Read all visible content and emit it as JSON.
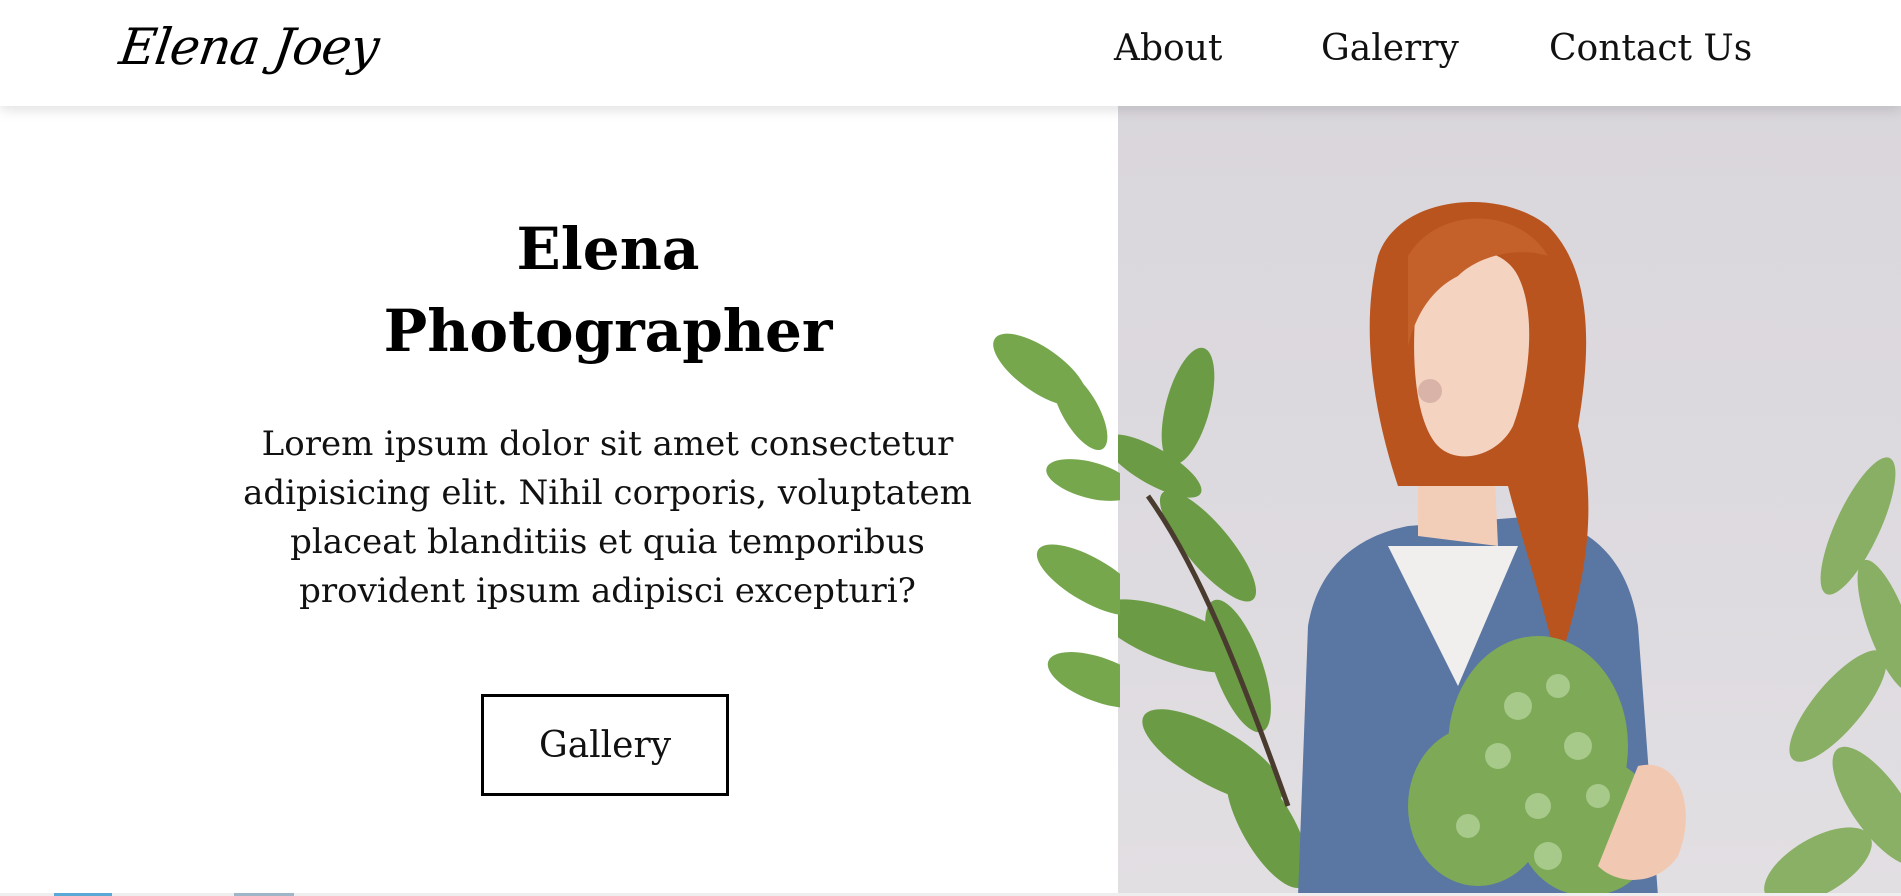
{
  "header": {
    "logo": "Elena Joey",
    "nav": [
      {
        "label": "About"
      },
      {
        "label": "Galerry"
      },
      {
        "label": "Contact Us"
      }
    ]
  },
  "hero": {
    "title_line1": "Elena",
    "title_line2": "Photographer",
    "description": "Lorem ipsum dolor sit amet consectetur adipisicing elit. Nihil corporis, voluptatem placeat blanditiis et quia temporibus provident ipsum adipisci excepturi?",
    "button_label": "Gallery"
  },
  "photo": {
    "subject": "woman-holding-plants-icon"
  },
  "colors": {
    "background": "#ffffff",
    "text": "#111111",
    "photo_background": "#dcd9de",
    "sweater": "#5a77a3",
    "hair": "#c25a2a",
    "leaf": "#6fa04a"
  }
}
